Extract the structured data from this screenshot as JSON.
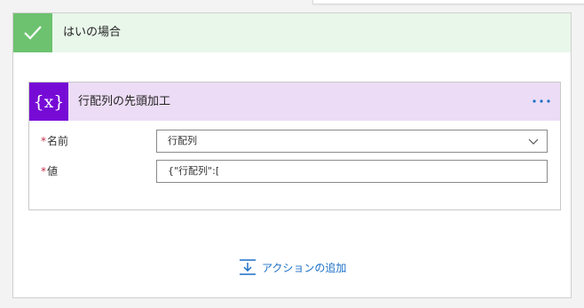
{
  "branch": {
    "title": "はいの場合",
    "check_icon": "checkmark-icon"
  },
  "action": {
    "icon_text": "{x}",
    "icon_name": "variable-icon",
    "title": "行配列の先頭加工",
    "more_icon": "ellipsis-icon",
    "fields": [
      {
        "required_mark": "*",
        "label": "名前",
        "value": "行配列",
        "type": "dropdown"
      },
      {
        "required_mark": "*",
        "label": "値",
        "value": "{\"行配列\":[",
        "type": "text"
      }
    ]
  },
  "add_action": {
    "label": "アクションの追加",
    "icon_name": "add-step-icon"
  },
  "colors": {
    "branch_header_bg": "#e8f7ea",
    "branch_check_bg": "#6cc26f",
    "action_header_bg": "#ecdcf5",
    "action_icon_bg": "#770bd6",
    "link_blue": "#1b6fc7",
    "required_red": "#c4314b"
  }
}
